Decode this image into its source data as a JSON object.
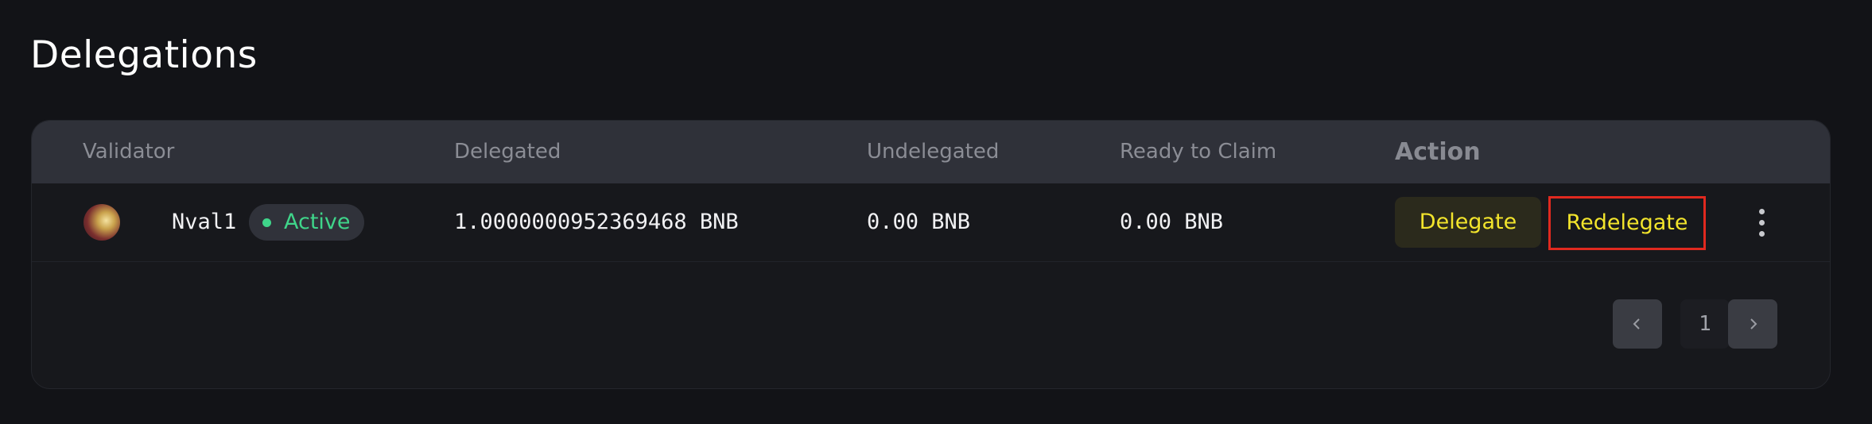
{
  "page": {
    "title": "Delegations"
  },
  "table": {
    "columns": {
      "validator": "Validator",
      "delegated": "Delegated",
      "undelegated": "Undelegated",
      "ready_to_claim": "Ready to Claim",
      "action": "Action"
    },
    "rows": [
      {
        "validator": "Nval1",
        "status": "Active",
        "delegated": "1.0000000952369468 BNB",
        "undelegated": "0.00 BNB",
        "ready_to_claim": "0.00 BNB",
        "actions": {
          "delegate": "Delegate",
          "redelegate": "Redelegate",
          "more": "more-vertical-icon"
        }
      }
    ]
  },
  "pagination": {
    "current_page": "1",
    "prev_icon": "chevron-left-icon",
    "next_icon": "chevron-right-icon"
  },
  "colors": {
    "background": "#121317",
    "card": "#17181c",
    "header": "#2f3139",
    "accent_yellow": "#f3e52c",
    "status_green": "#3fd58a",
    "highlight_red": "#e0291f"
  }
}
